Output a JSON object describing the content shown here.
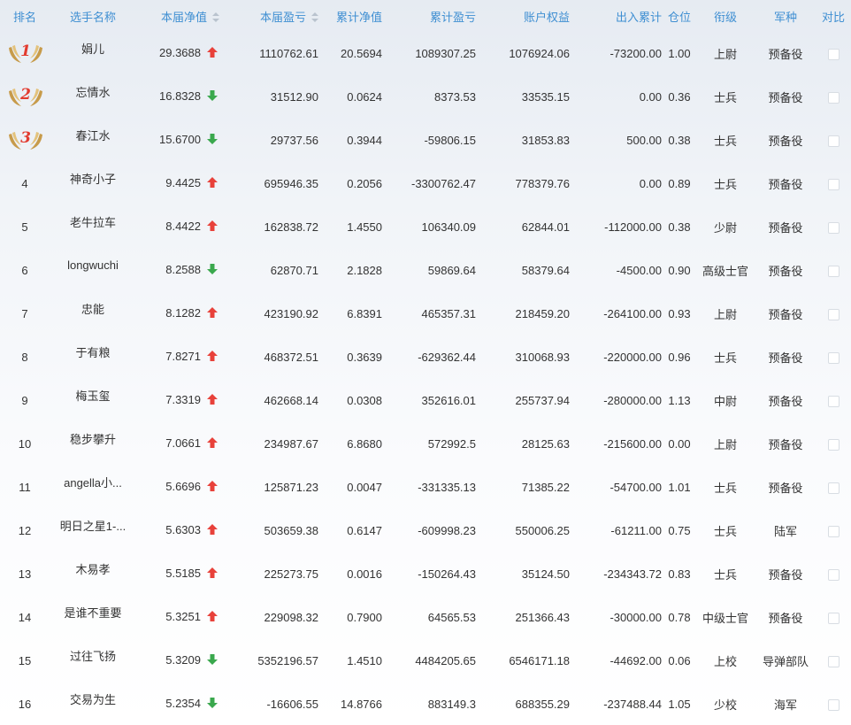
{
  "header": {
    "rank": "排名",
    "name": "选手名称",
    "nav": "本届净值",
    "pnl": "本届盈亏",
    "cum_nav": "累计净值",
    "cum_pnl": "累计盈亏",
    "equity": "账户权益",
    "inout": "出入累计",
    "position": "仓位",
    "title": "衔级",
    "branch": "军种",
    "compare": "对比"
  },
  "colors": {
    "up": "#e8413a",
    "down": "#3aa84d",
    "header_text": "#3f8fd2",
    "medal_red": "#e23a2e",
    "medal_gold": "#c79b4a"
  },
  "rows": [
    {
      "rank": "1",
      "medal": true,
      "name": "娟儿",
      "nav": "29.3688",
      "trend": "up",
      "pnl": "1110762.61",
      "cum_nav": "20.5694",
      "cum_pnl": "1089307.25",
      "equity": "1076924.06",
      "inout": "-73200.00",
      "position": "1.00",
      "title": "上尉",
      "branch": "预备役"
    },
    {
      "rank": "2",
      "medal": true,
      "name": "忘情水",
      "nav": "16.8328",
      "trend": "down",
      "pnl": "31512.90",
      "cum_nav": "0.0624",
      "cum_pnl": "8373.53",
      "equity": "33535.15",
      "inout": "0.00",
      "position": "0.36",
      "title": "士兵",
      "branch": "预备役"
    },
    {
      "rank": "3",
      "medal": true,
      "name": "春江水",
      "nav": "15.6700",
      "trend": "down",
      "pnl": "29737.56",
      "cum_nav": "0.3944",
      "cum_pnl": "-59806.15",
      "equity": "31853.83",
      "inout": "500.00",
      "position": "0.38",
      "title": "士兵",
      "branch": "预备役"
    },
    {
      "rank": "4",
      "medal": false,
      "name": "神奇小子",
      "nav": "9.4425",
      "trend": "up",
      "pnl": "695946.35",
      "cum_nav": "0.2056",
      "cum_pnl": "-3300762.47",
      "equity": "778379.76",
      "inout": "0.00",
      "position": "0.89",
      "title": "士兵",
      "branch": "预备役"
    },
    {
      "rank": "5",
      "medal": false,
      "name": "老牛拉车",
      "nav": "8.4422",
      "trend": "up",
      "pnl": "162838.72",
      "cum_nav": "1.4550",
      "cum_pnl": "106340.09",
      "equity": "62844.01",
      "inout": "-112000.00",
      "position": "0.38",
      "title": "少尉",
      "branch": "预备役"
    },
    {
      "rank": "6",
      "medal": false,
      "name": "longwuchi",
      "nav": "8.2588",
      "trend": "down",
      "pnl": "62870.71",
      "cum_nav": "2.1828",
      "cum_pnl": "59869.64",
      "equity": "58379.64",
      "inout": "-4500.00",
      "position": "0.90",
      "title": "高级士官",
      "branch": "预备役"
    },
    {
      "rank": "7",
      "medal": false,
      "name": "忠能",
      "nav": "8.1282",
      "trend": "up",
      "pnl": "423190.92",
      "cum_nav": "6.8391",
      "cum_pnl": "465357.31",
      "equity": "218459.20",
      "inout": "-264100.00",
      "position": "0.93",
      "title": "上尉",
      "branch": "预备役"
    },
    {
      "rank": "8",
      "medal": false,
      "name": "于有粮",
      "nav": "7.8271",
      "trend": "up",
      "pnl": "468372.51",
      "cum_nav": "0.3639",
      "cum_pnl": "-629362.44",
      "equity": "310068.93",
      "inout": "-220000.00",
      "position": "0.96",
      "title": "士兵",
      "branch": "预备役"
    },
    {
      "rank": "9",
      "medal": false,
      "name": "梅玉玺",
      "nav": "7.3319",
      "trend": "up",
      "pnl": "462668.14",
      "cum_nav": "0.0308",
      "cum_pnl": "352616.01",
      "equity": "255737.94",
      "inout": "-280000.00",
      "position": "1.13",
      "title": "中尉",
      "branch": "预备役"
    },
    {
      "rank": "10",
      "medal": false,
      "name": "稳步攀升",
      "nav": "7.0661",
      "trend": "up",
      "pnl": "234987.67",
      "cum_nav": "6.8680",
      "cum_pnl": "572992.5",
      "equity": "28125.63",
      "inout": "-215600.00",
      "position": "0.00",
      "title": "上尉",
      "branch": "预备役"
    },
    {
      "rank": "11",
      "medal": false,
      "name": "angella小...",
      "nav": "5.6696",
      "trend": "up",
      "pnl": "125871.23",
      "cum_nav": "0.0047",
      "cum_pnl": "-331335.13",
      "equity": "71385.22",
      "inout": "-54700.00",
      "position": "1.01",
      "title": "士兵",
      "branch": "预备役"
    },
    {
      "rank": "12",
      "medal": false,
      "name": "明日之星1-...",
      "nav": "5.6303",
      "trend": "up",
      "pnl": "503659.38",
      "cum_nav": "0.6147",
      "cum_pnl": "-609998.23",
      "equity": "550006.25",
      "inout": "-61211.00",
      "position": "0.75",
      "title": "士兵",
      "branch": "陆军"
    },
    {
      "rank": "13",
      "medal": false,
      "name": "木易孝",
      "nav": "5.5185",
      "trend": "up",
      "pnl": "225273.75",
      "cum_nav": "0.0016",
      "cum_pnl": "-150264.43",
      "equity": "35124.50",
      "inout": "-234343.72",
      "position": "0.83",
      "title": "士兵",
      "branch": "预备役"
    },
    {
      "rank": "14",
      "medal": false,
      "name": "是谁不重要",
      "nav": "5.3251",
      "trend": "up",
      "pnl": "229098.32",
      "cum_nav": "0.7900",
      "cum_pnl": "64565.53",
      "equity": "251366.43",
      "inout": "-30000.00",
      "position": "0.78",
      "title": "中级士官",
      "branch": "预备役"
    },
    {
      "rank": "15",
      "medal": false,
      "name": "过往飞扬",
      "nav": "5.3209",
      "trend": "down",
      "pnl": "5352196.57",
      "cum_nav": "1.4510",
      "cum_pnl": "4484205.65",
      "equity": "6546171.18",
      "inout": "-44692.00",
      "position": "0.06",
      "title": "上校",
      "branch": "导弹部队"
    },
    {
      "rank": "16",
      "medal": false,
      "name": "交易为生",
      "nav": "5.2354",
      "trend": "down",
      "pnl": "-16606.55",
      "cum_nav": "14.8766",
      "cum_pnl": "883149.3",
      "equity": "688355.29",
      "inout": "-237488.44",
      "position": "1.05",
      "title": "少校",
      "branch": "海军"
    }
  ]
}
